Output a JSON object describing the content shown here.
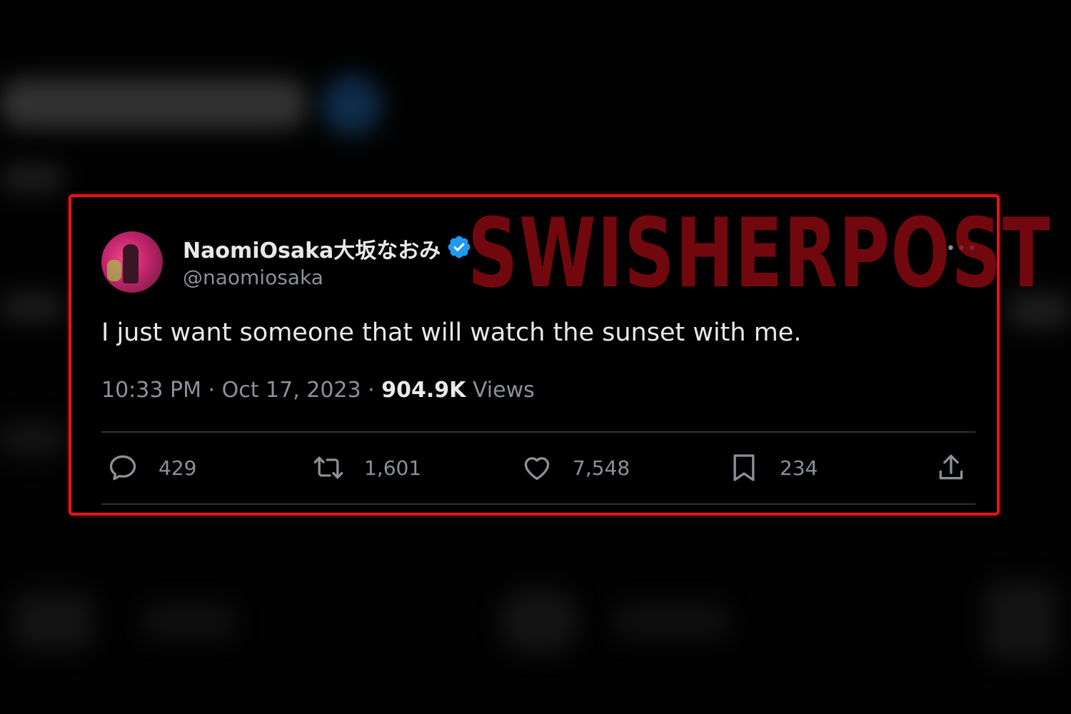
{
  "tweet": {
    "display_name": "NaomiOsaka大坂なおみ",
    "handle": "@naomiosaka",
    "more_icon": "more-options-icon",
    "verified_icon": "verified-badge-icon",
    "text": "I just want someone that will watch the sunset with me.",
    "time": "10:33 PM",
    "separator": "·",
    "date": "Oct 17, 2023",
    "views_count": "904.9K",
    "views_label": "Views"
  },
  "actions": {
    "replies": {
      "icon": "reply-icon",
      "count": "429"
    },
    "retweets": {
      "icon": "retweet-icon",
      "count": "1,601"
    },
    "likes": {
      "icon": "heart-icon",
      "count": "7,548"
    },
    "bookmarks": {
      "icon": "bookmark-icon",
      "count": "234"
    },
    "share": {
      "icon": "share-icon"
    }
  },
  "watermark": {
    "text": "SWISHERPOST"
  },
  "colors": {
    "highlight_border": "#e0141b",
    "verified_blue": "#1d9bf0",
    "muted_text": "#8b9197",
    "primary_text": "#e7e9ea",
    "watermark": "#8a0a12"
  }
}
